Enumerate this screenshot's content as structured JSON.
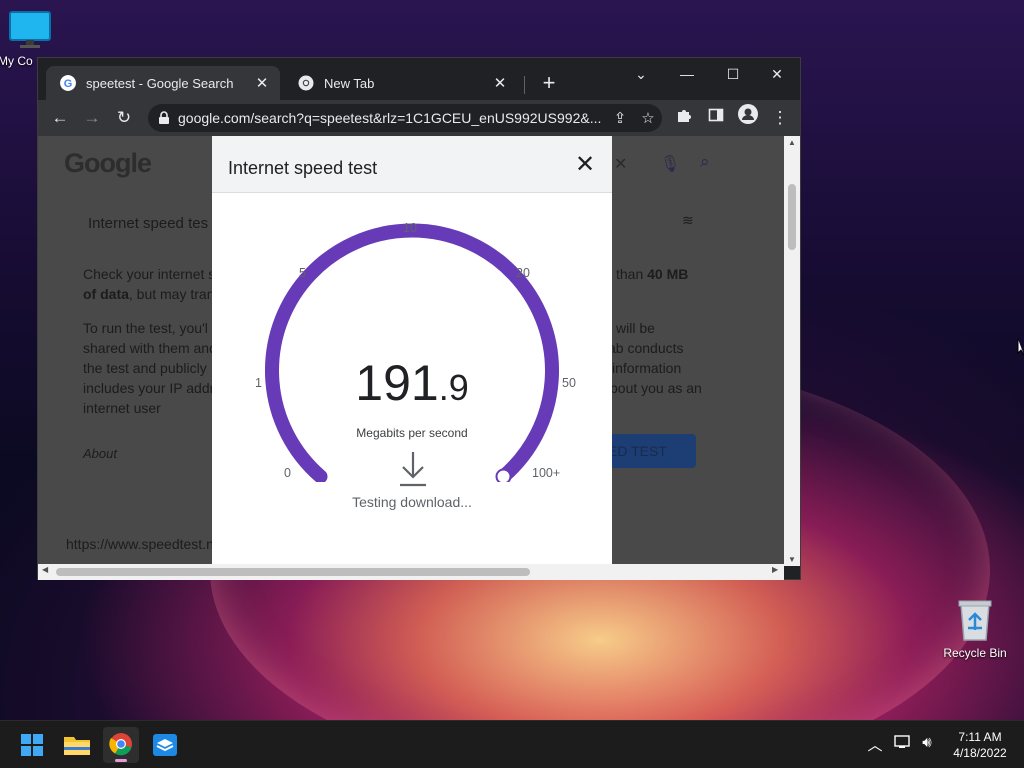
{
  "desktop": {
    "icons": [
      {
        "label": "My Co"
      },
      {
        "label": "Recycle Bin"
      }
    ]
  },
  "browser": {
    "tabs": [
      {
        "title": "speetest - Google Search",
        "active": true
      },
      {
        "title": "New Tab",
        "active": false
      }
    ],
    "new_tab_glyph": "+",
    "window_controls": {
      "dropdown": "⌄",
      "minimize": "—",
      "maximize": "☐",
      "close": "✕"
    },
    "address": {
      "url": "google.com/search?q=speetest&rlz=1C1GCEU_enUS992US992&..."
    },
    "nav": {
      "back": "←",
      "forward": "→",
      "reload": "↻"
    }
  },
  "background_page": {
    "logo": "Google",
    "heading": "Internet speed tes",
    "para1_line1": "Check your internet s",
    "para1_line1_right_a": "than",
    "para1_line1_right_b": "40 MB",
    "para1_line2_bold": "of data",
    "para1_line2": ", but may tran",
    "para2_lines_left": [
      "To run the test, you'l",
      "shared with them and",
      "the test and publicly",
      "includes your IP addr",
      "internet user"
    ],
    "para2_lines_right": [
      "will be",
      "ab conducts",
      "information",
      "bout you as an"
    ],
    "about": "About",
    "run_button_partial": "ED TEST",
    "footer_link": "https://www.speedtest.n"
  },
  "speed_dialog": {
    "title": "Internet speed test",
    "close_glyph": "✕",
    "speed_whole": "191",
    "speed_fraction": ".9",
    "unit": "Megabits per second",
    "status": "Testing download...",
    "gauge_fill_fraction": 1.0,
    "gauge_color": "#673ab7",
    "tick_labels": [
      "0",
      "1",
      "5",
      "10",
      "20",
      "50",
      "100+"
    ]
  },
  "taskbar": {
    "apps": [
      "start-icon",
      "file-explorer-icon",
      "chrome-icon",
      "app-store-icon"
    ],
    "time": "7:11 AM",
    "date": "4/18/2022"
  }
}
